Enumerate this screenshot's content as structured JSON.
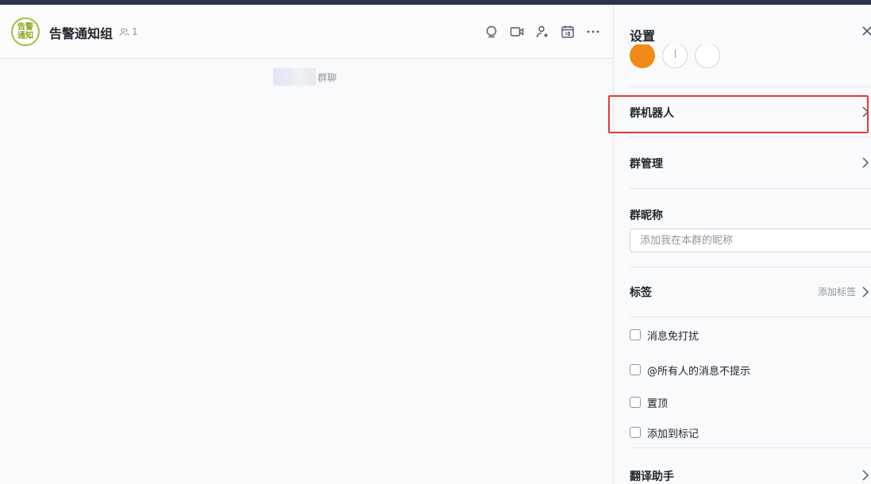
{
  "chat": {
    "avatar_text": "告警通知",
    "group_title": "告警通知组",
    "member_count": "1",
    "system_message": "群聊"
  },
  "header_icons": [
    "search-icon",
    "video-icon",
    "add-member-icon",
    "calendar-icon",
    "more-icon"
  ],
  "settings": {
    "title": "设置",
    "rows": {
      "group_bot": "群机器人",
      "group_manage": "群管理",
      "tags": "标签",
      "tags_sub": "添加标签",
      "translate": "翻译助手"
    },
    "nickname": {
      "label": "群昵称",
      "placeholder": "添加我在本群的昵称"
    },
    "checkboxes": {
      "mute": "消息免打扰",
      "at_all_silent": "@所有人的消息不提示",
      "pin": "置顶",
      "mark": "添加到标记"
    }
  },
  "colors": {
    "accent_avatar": "#a2bd3a",
    "highlight": "#e53935",
    "member_avatar": "#f08a16"
  }
}
